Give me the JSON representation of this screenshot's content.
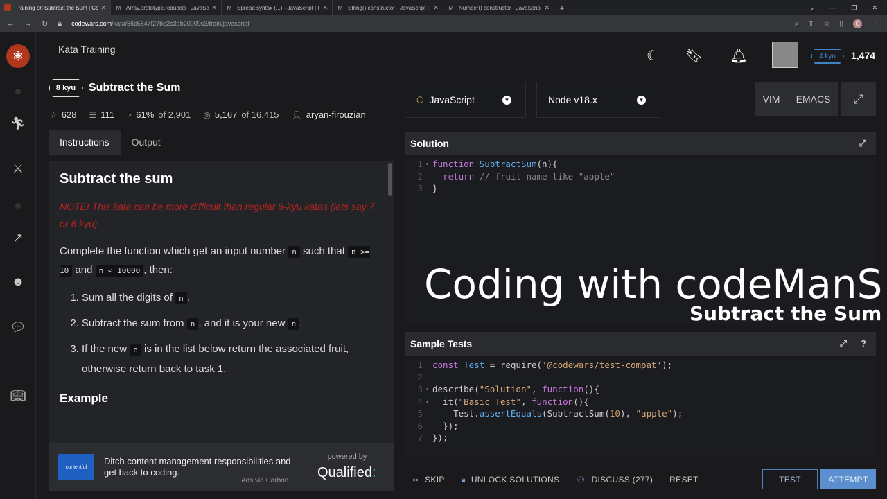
{
  "browser": {
    "tabs": [
      {
        "title": "Training on Subtract the Sum | Co"
      },
      {
        "title": "Array.prototype.reduce() - JavaSc"
      },
      {
        "title": "Spread syntax (...) - JavaScript | M"
      },
      {
        "title": "String() constructor - JavaScript |"
      },
      {
        "title": "Number() constructor - JavaScrip"
      }
    ],
    "url_domain": "codewars.com",
    "url_path": "/kata/56c5847f27be2c3db20009c3/train/javascript",
    "profile_initial": "C"
  },
  "nav": {
    "section_title": "Kata Training",
    "rank": "4 kyu",
    "honor": "1,474"
  },
  "kata": {
    "rank": "8 kyu",
    "title": "Subtract the Sum",
    "stars": "628",
    "collections": "111",
    "satisfaction": "61%",
    "satisfaction_of": "of 2,901",
    "completed": "5,167",
    "completed_of": "of 16,415",
    "author": "aryan-firouzian"
  },
  "desc_tabs": {
    "instructions": "Instructions",
    "output": "Output"
  },
  "description": {
    "heading": "Subtract the sum",
    "note": "NOTE! This kata can be more difficult than regular 8-kyu katas (lets say 7 or 6 kyu)",
    "p1_a": "Complete the function which get an input number",
    "p1_code_n": "n",
    "p1_b": "such that",
    "p1_code_c1": "n >= 10",
    "p1_and": "and",
    "p1_code_c2": "n < 10000",
    "p1_c": ", then:",
    "step1_a": "Sum all the digits of",
    "step1_code": "n",
    "step1_b": ".",
    "step2_a": "Subtract the sum from",
    "step2_code": "n",
    "step2_b": ", and it is your new",
    "step2_code2": "n",
    "step2_c": ".",
    "step3_a": "If the new",
    "step3_code": "n",
    "step3_b": "is in the list below return the associated fruit, otherwise return back to task 1.",
    "example_heading": "Example"
  },
  "ad": {
    "logo_text": "contentful",
    "text": "Ditch content management responsibilities and get back to coding.",
    "ads_via": "Ads via Carbon",
    "powered_by": "powered by",
    "brand": "Qualified",
    "brand_colon": ":"
  },
  "editor": {
    "language": "JavaScript",
    "version": "Node v18.x",
    "mode_vim": "VIM",
    "mode_emacs": "EMACS",
    "solution_title": "Solution",
    "tests_title": "Sample Tests"
  },
  "overlay": {
    "title": "Coding with codeManS",
    "subtitle": "Subtract the Sum"
  },
  "actions": {
    "skip": "SKIP",
    "unlock": "UNLOCK SOLUTIONS",
    "discuss": "DISCUSS (277)",
    "reset": "RESET",
    "test": "TEST",
    "attempt": "ATTEMPT"
  },
  "colors": {
    "brand_red": "#b1361e",
    "kyu_blue": "#3e82c6",
    "attempt_blue": "#5b8fcf",
    "note_red": "#b8231e"
  }
}
